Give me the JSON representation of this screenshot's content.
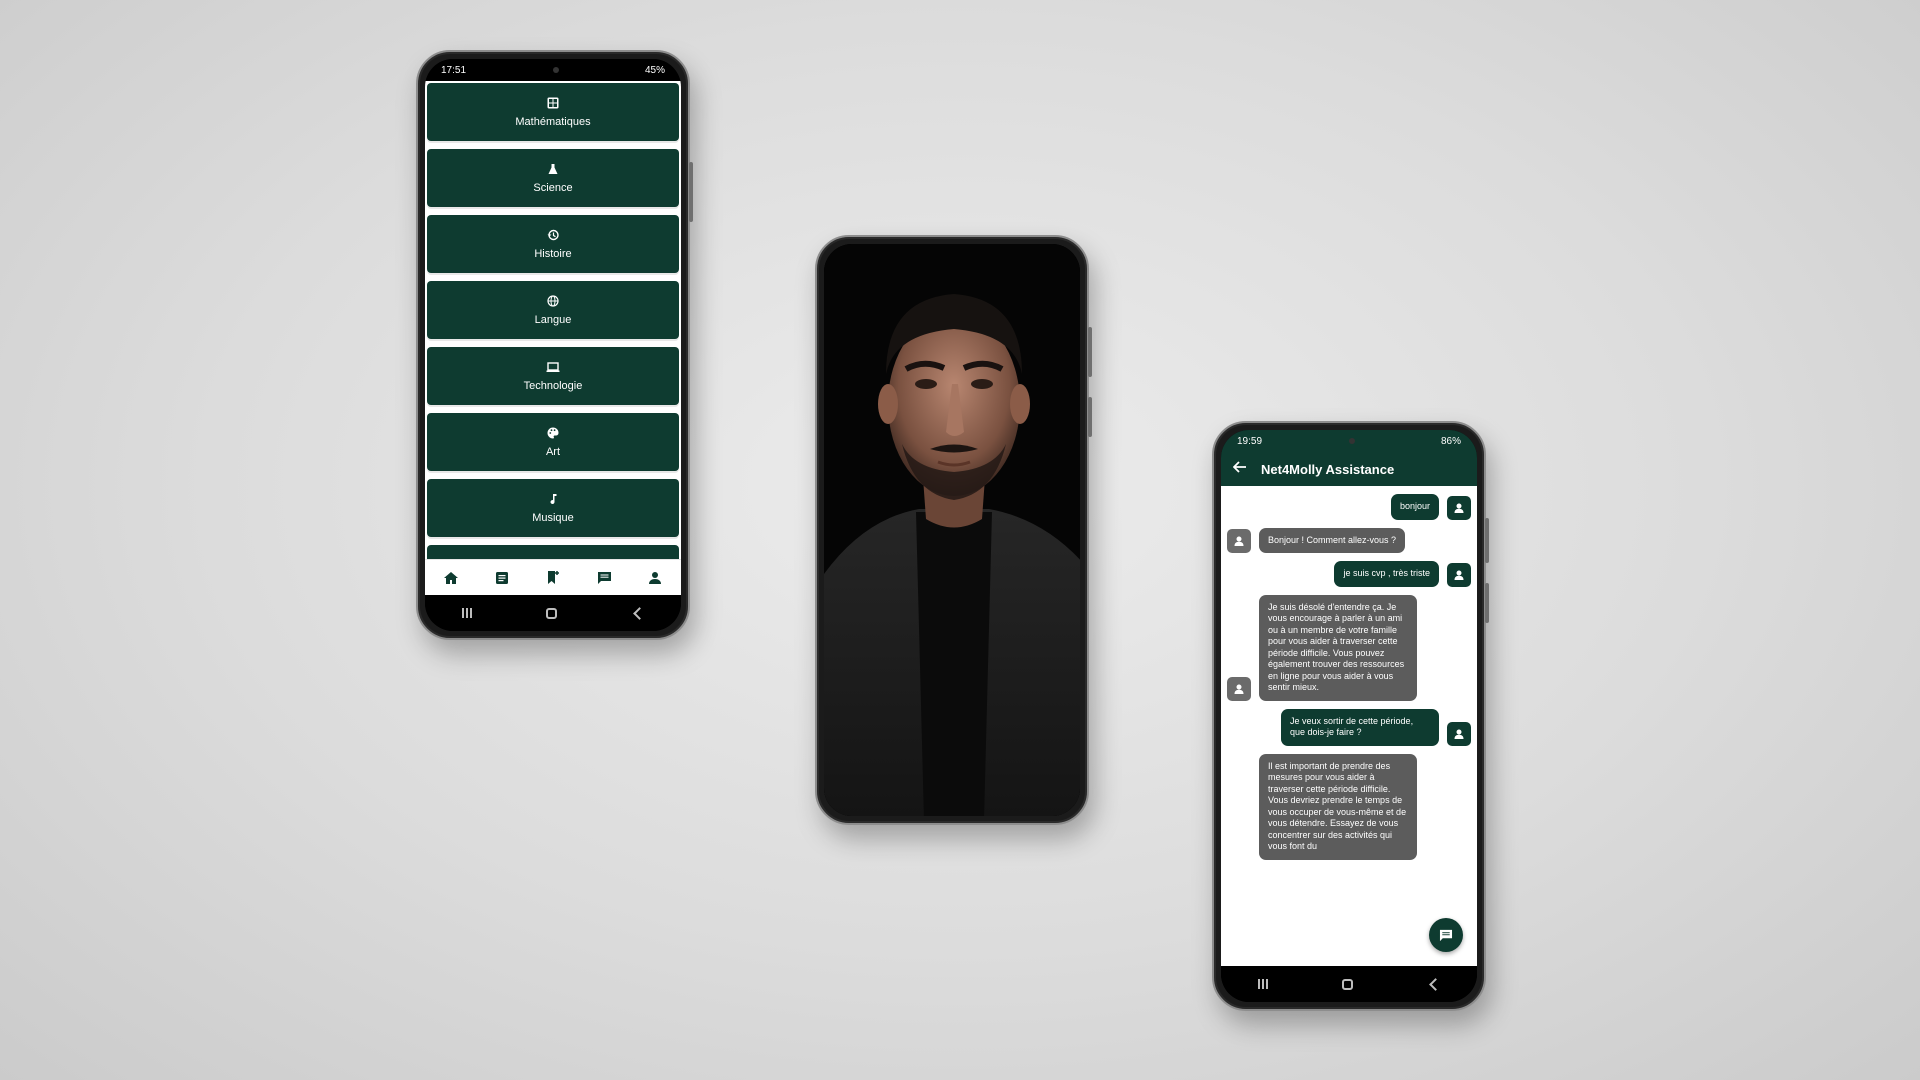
{
  "phone_subjects": {
    "status_time": "17:51",
    "status_battery": "45%",
    "subjects": [
      {
        "label": "Mathématiques",
        "icon": "calculator-icon"
      },
      {
        "label": "Science",
        "icon": "flask-icon"
      },
      {
        "label": "Histoire",
        "icon": "history-icon"
      },
      {
        "label": "Langue",
        "icon": "globe-icon"
      },
      {
        "label": "Technologie",
        "icon": "laptop-icon"
      },
      {
        "label": "Art",
        "icon": "palette-icon"
      },
      {
        "label": "Musique",
        "icon": "music-note-icon"
      }
    ],
    "bottom_tabs": [
      "home-icon",
      "article-icon",
      "bookmark-add-icon",
      "chat-icon",
      "person-icon"
    ]
  },
  "phone_chat": {
    "status_time": "19:59",
    "status_battery": "86%",
    "title": "Net4Molly Assistance",
    "messages": [
      {
        "from": "user",
        "text": "bonjour"
      },
      {
        "from": "bot",
        "text": "Bonjour ! Comment allez-vous ?"
      },
      {
        "from": "user",
        "text": "je suis cvp , très triste"
      },
      {
        "from": "bot",
        "text": "Je suis désolé d'entendre ça. Je vous encourage à parler à un ami ou à un membre de votre famille pour vous aider à traverser cette période difficile. Vous pouvez également trouver des ressources en ligne pour vous aider à vous sentir mieux."
      },
      {
        "from": "user",
        "text": "Je veux sortir de cette période, que dois-je faire ?"
      },
      {
        "from": "bot",
        "text": "Il est important de prendre des mesures pour vous aider à traverser cette période difficile. Vous devriez prendre le temps de vous occuper de vous-même et de vous détendre. Essayez de vous concentrer sur des activités qui vous font du"
      }
    ]
  },
  "colors": {
    "primary": "#0e3b30",
    "bot_bubble": "#5c5c5c",
    "background": "#dcdcdc"
  }
}
